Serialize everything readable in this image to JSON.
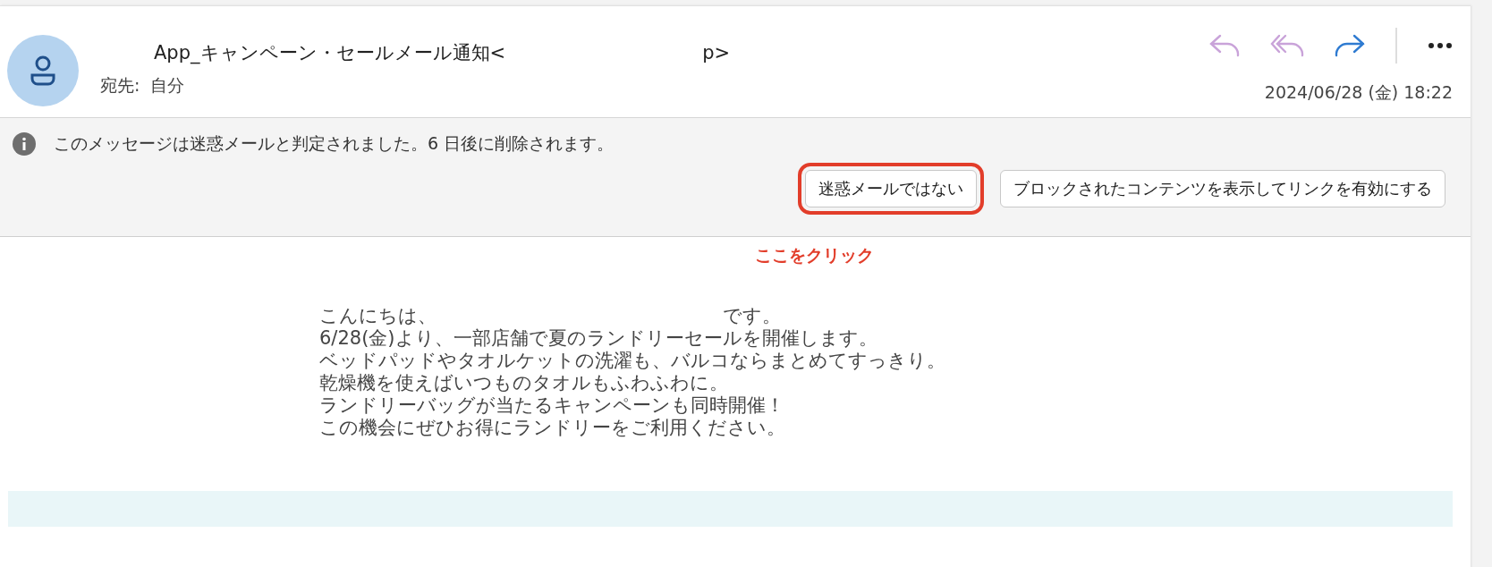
{
  "header": {
    "sender_prefix": "App_キャンペーン・セールメール通知<",
    "sender_suffix": "p>",
    "recipient_label": "宛先:",
    "recipient": "自分",
    "date": "2024/06/28 (金) 18:22"
  },
  "actions": [
    {
      "kind": "reply",
      "color": "#c9a3d9"
    },
    {
      "kind": "reply-all",
      "color": "#c9a3d9"
    },
    {
      "kind": "forward",
      "color": "#2f7bd1"
    },
    {
      "kind": "more",
      "color": "#222222"
    }
  ],
  "junk_notice": {
    "message": "このメッセージは迷惑メールと判定されました。6 日後に削除されます。",
    "buttons": [
      {
        "label": "迷惑メールではない",
        "highlighted": true
      },
      {
        "label": "ブロックされたコンテンツを表示してリンクを有効にする",
        "highlighted": false
      }
    ],
    "annotation": "ここをクリック"
  },
  "body": {
    "greeting_start": "こんにちは、",
    "greeting_end": "です。",
    "lines": [
      "6/28(金)より、一部店舗で夏のランドリーセールを開催します。",
      "ベッドパッドやタオルケットの洗濯も、バルコならまとめてすっきり。",
      "乾燥機を使えばいつものタオルもふわふわに。",
      "ランドリーバッグが当たるキャンペーンも同時開催！",
      "この機会にぜひお得にランドリーをご利用ください。"
    ]
  }
}
